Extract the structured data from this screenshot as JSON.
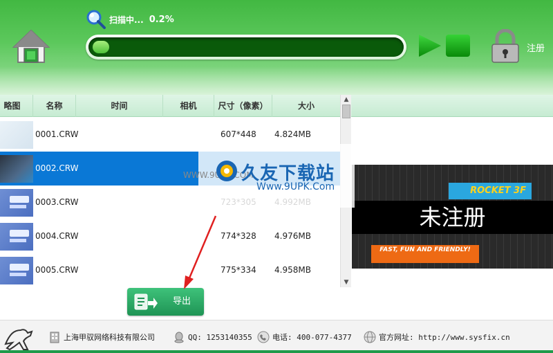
{
  "header": {
    "scan_label": "扫描中...",
    "scan_percent": "0.2%",
    "progress_fraction": 0.002,
    "register_label": "注册"
  },
  "table": {
    "columns": [
      "略图",
      "名称",
      "时间",
      "相机",
      "尺寸（像素）",
      "大小"
    ],
    "rows": [
      {
        "name": "0001.CRW",
        "time": "",
        "camera": "",
        "dimensions": "607*448",
        "filesize": "4.824MB",
        "selected": false
      },
      {
        "name": "0002.CRW",
        "time": "",
        "camera": "",
        "dimensions": "",
        "filesize": "",
        "selected": true
      },
      {
        "name": "0003.CRW",
        "time": "",
        "camera": "",
        "dimensions": "723*305",
        "filesize": "4.992MB",
        "selected": false
      },
      {
        "name": "0004.CRW",
        "time": "",
        "camera": "",
        "dimensions": "774*328",
        "filesize": "4.976MB",
        "selected": false
      },
      {
        "name": "0005.CRW",
        "time": "",
        "camera": "",
        "dimensions": "775*334",
        "filesize": "4.958MB",
        "selected": false
      }
    ]
  },
  "preview": {
    "overlay_text": "未注册",
    "banner_text": "ROCKET 3F",
    "slogan": "FAST, FUN AND FRIENDLY!"
  },
  "export_button": {
    "label": "导出"
  },
  "watermark": {
    "title": "久友下载站",
    "url": "Www.9UPK.Com",
    "faint": "WWW.9UPK.COM"
  },
  "footer": {
    "company": "上海甲驭网络科技有限公司",
    "qq": "QQ: 1253140355",
    "phone": "电话: 400-077-4377",
    "website": "官方网址: http://www.sysfix.cn"
  },
  "colors": {
    "header_green": "#42b842",
    "selected_row": "#0a78d6",
    "export_green": "#1f9455",
    "arrow_red": "#e02020"
  },
  "icons": [
    "home-icon",
    "search-icon",
    "play-icon",
    "stop-icon",
    "lock-icon",
    "export-icon",
    "building-icon",
    "qq-icon",
    "phone-icon",
    "globe-icon",
    "horse-logo"
  ]
}
